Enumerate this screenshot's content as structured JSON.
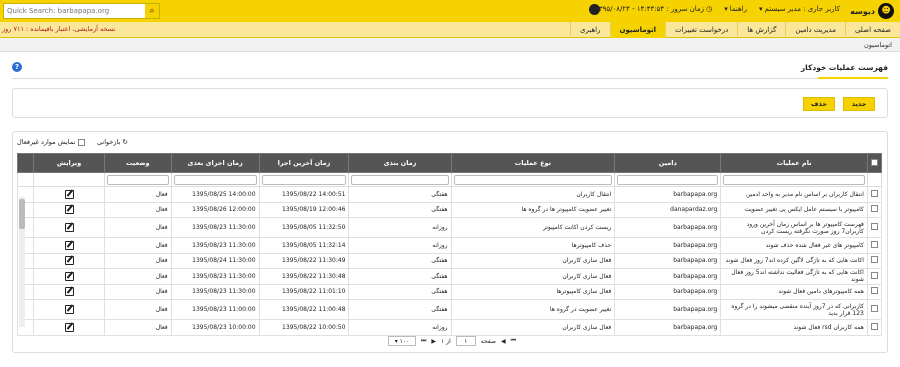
{
  "app": {
    "brand": "دیوسه",
    "logo_glyph": "☻"
  },
  "header": {
    "user_label": "کاربر جاری : مدیر سیستم",
    "guides_label": "راهنما",
    "server_time": "زمان سرور : ۱۴:۴۴:۵۴ - ۱۳۹۵/۰۸/۲۴",
    "search_placeholder": "Quick Search: barbapapa.org",
    "search_icon": "search-icon"
  },
  "nav": {
    "tabs": [
      "صفحه اصلی",
      "مدیریت دامین",
      "گزارش ها",
      "درخواست تغییرات",
      "اتوماسیون",
      "راهبری"
    ],
    "active_index": 4,
    "warning": "نسخه آزمایشی، اعتبار باقیمانده : ۷۱۱ روز"
  },
  "breadcrumb": "اتوماسیون",
  "page": {
    "title": "فهرست عملیات خودکار"
  },
  "buttons": {
    "new": "جدید",
    "delete": "حذف"
  },
  "grid_toolbar": {
    "refresh": "بازخوانی",
    "show_inactive": "نمایش موارد غیرفعال"
  },
  "table": {
    "headers": [
      "نام عملیات",
      "دامین",
      "نوع عملیات",
      "زمان بندی",
      "زمان آخرین اجرا",
      "زمان اجرای بعدی",
      "وضعیت",
      "ویرایش"
    ],
    "rows": [
      {
        "name": "انتقال کاربران بر اساس نام مدیر به واحد ادمین",
        "domain": "barbapapa.org",
        "type": "انتقال کاربران",
        "schedule": "هفتگی",
        "last_run": "1395/08/22  14:00:51",
        "next_run": "1395/08/25  14:00:00",
        "status": "فعال"
      },
      {
        "name": "کامپیوتر با سیستم عامل ایکس پی تغییر عضویت",
        "domain": "danapardaz.org",
        "type": "تغییر عضویت کامپیوتر ها در گروه ها",
        "schedule": "هفتگی",
        "last_run": "1395/08/19  12:00:46",
        "next_run": "1395/08/26  12:00:00",
        "status": "فعال"
      },
      {
        "name": "فهرست کامپیوتر ها بر اساس زمان آخرین ورود کاربران7 روز صورت نگرفته ریست کردن",
        "domain": "barbapapa.org",
        "type": "ریست کردن اکانت کامپیوتر",
        "schedule": "روزانه",
        "last_run": "1395/08/05  11:32:50",
        "next_run": "1395/08/23  11:30:00",
        "status": "فعال",
        "tall": true
      },
      {
        "name": "کامپیوتر های غیر فعال شده حذف شوند",
        "domain": "barbapapa.org",
        "type": "حذف کامپیوترها",
        "schedule": "روزانه",
        "last_run": "1395/08/05  11:32:14",
        "next_run": "1395/08/23  11:30:00",
        "status": "فعال"
      },
      {
        "name": "اکانت هایی که به تازگی لاگین کرده اند7 روز فعال شوند",
        "domain": "barbapapa.org",
        "type": "فعال سازی کاربران",
        "schedule": "هفتگی",
        "last_run": "1395/08/22  11:30:49",
        "next_run": "1395/08/24  11:30:00",
        "status": "فعال"
      },
      {
        "name": "اکانت هایی که به تازگی فعالیت نداشته اند5 روز فعال شوند",
        "domain": "barbapapa.org",
        "type": "فعال سازی کاربران",
        "schedule": "هفتگی",
        "last_run": "1395/08/22  11:30:48",
        "next_run": "1395/08/23  11:30:00",
        "status": "فعال"
      },
      {
        "name": "همه کامپیوترهای دامین فعال شوند",
        "domain": "barbapapa.org",
        "type": "فعال سازی کامپیوترها",
        "schedule": "هفتگی",
        "last_run": "1395/08/22  11:01:10",
        "next_run": "1395/08/23  11:30:00",
        "status": "فعال"
      },
      {
        "name": "کاربرانی که در 7روز آینده منقضی میشوند را در گروه 123 قرار بدید",
        "domain": "barbapapa.org",
        "type": "تغییر عضویت در گروه ها",
        "schedule": "هفتگی",
        "last_run": "1395/08/22  11:00:48",
        "next_run": "1395/08/23  11:00:00",
        "status": "فعال",
        "tall": true
      },
      {
        "name": "همه کاربران rsd فعال شوند",
        "domain": "barbapapa.org",
        "type": "فعال سازی کاربران",
        "schedule": "روزانه",
        "last_run": "1395/08/22  10:00:50",
        "next_run": "1395/08/23  10:00:00",
        "status": "فعال"
      }
    ]
  },
  "pager": {
    "page_label": "صفحه",
    "page_value": "۱",
    "of_label": "از ۱",
    "page_size": "۱۰۰"
  }
}
